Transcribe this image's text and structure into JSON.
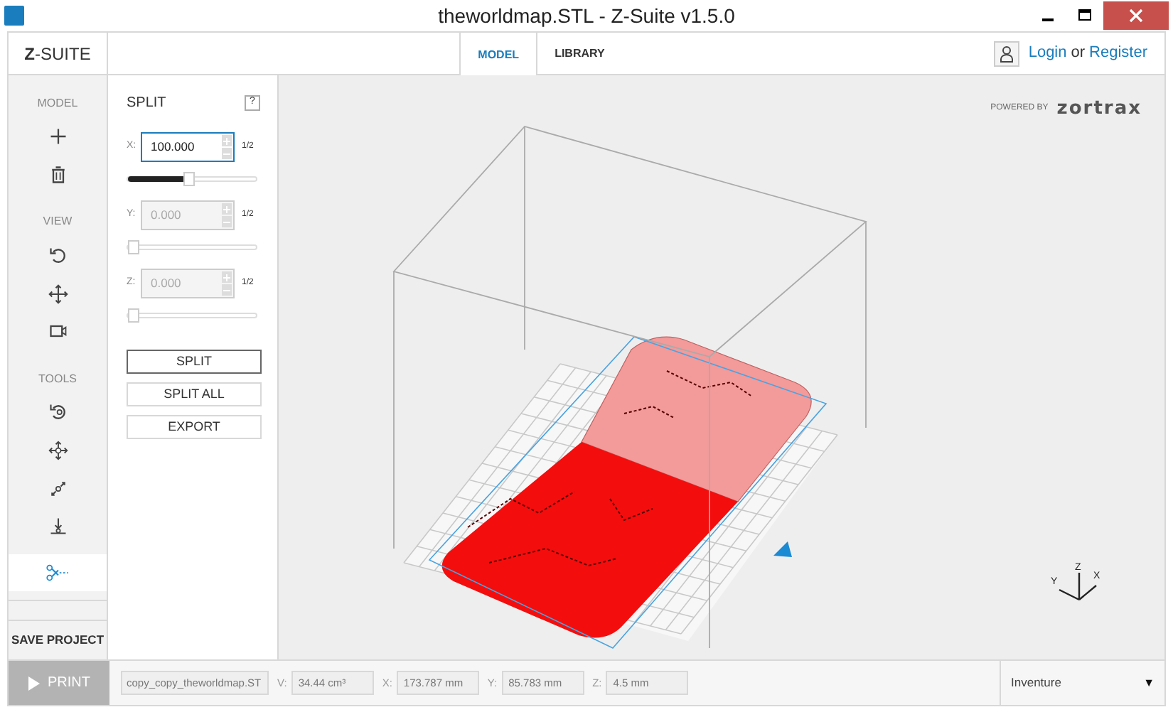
{
  "window": {
    "title": "theworldmap.STL - Z-Suite v1.5.0"
  },
  "app_logo": "**Z**-SUITE",
  "tabs": [
    {
      "label": "MODEL",
      "selected": true
    },
    {
      "label": "LIBRARY",
      "selected": false
    }
  ],
  "account": {
    "login": "Login",
    "or": "or",
    "register": "Register"
  },
  "toolbar": [
    {
      "title": "MODEL",
      "tools": [
        {
          "kind": "plus",
          "selected": false
        },
        {
          "kind": "trash",
          "selected": false
        }
      ]
    },
    {
      "title": "VIEW",
      "tools": [
        {
          "kind": "rotate",
          "selected": false
        },
        {
          "kind": "move",
          "selected": false
        },
        {
          "kind": "camera",
          "selected": false
        }
      ]
    },
    {
      "title": "TOOLS",
      "tools": [
        {
          "kind": "rotatemodel",
          "selected": false
        },
        {
          "kind": "movemodel",
          "selected": false
        },
        {
          "kind": "scale",
          "selected": false
        },
        {
          "kind": "drop",
          "selected": false
        },
        {
          "kind": "scissors",
          "selected": true
        }
      ]
    }
  ],
  "save_project": "SAVE PROJECT",
  "print": "PRINT",
  "split_panel": {
    "title": "SPLIT",
    "help": "?",
    "axes": [
      {
        "label": "X:",
        "value": "100.000",
        "half": "1/2",
        "disabled": false,
        "level": 0.47
      },
      {
        "label": "Y:",
        "value": "0.000",
        "half": "1/2",
        "disabled": true,
        "level": 0
      },
      {
        "label": "Z:",
        "value": "0.000",
        "half": "1/2",
        "disabled": true,
        "level": 0
      }
    ],
    "buttons": [
      {
        "label": "SPLIT",
        "focused": true
      },
      {
        "label": "SPLIT ALL",
        "focused": false
      },
      {
        "label": "EXPORT",
        "focused": false
      }
    ]
  },
  "viewport": {
    "powered_by": "POWERED BY",
    "brand": "zortrax",
    "axis_labels": [
      "Y",
      "Z",
      "X"
    ]
  },
  "status_bar": {
    "file": "copy_copy_theworldmap.ST",
    "fields": [
      {
        "label": "V:",
        "value": "34.44 cm³"
      },
      {
        "label": "X:",
        "value": "173.787 mm"
      },
      {
        "label": "Y:",
        "value": "85.783 mm"
      },
      {
        "label": "Z:",
        "value": "4.5 mm"
      }
    ],
    "printer": "Inventure",
    "dropdown_arrow": "▼"
  }
}
